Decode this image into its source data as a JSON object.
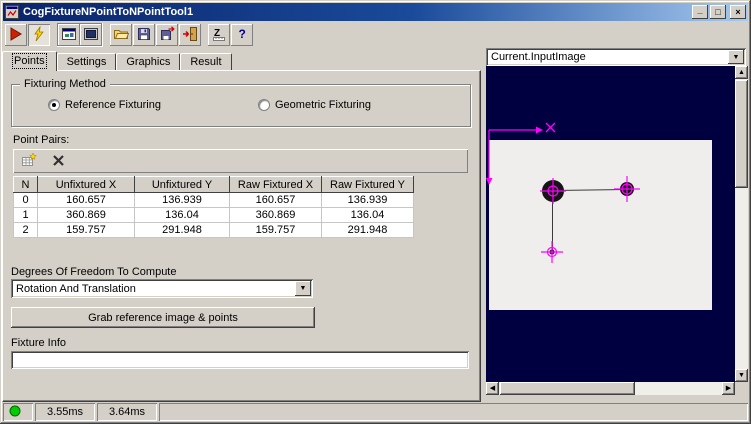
{
  "window": {
    "title": "CogFixtureNPointToNPointTool1",
    "minimize_label": "_",
    "maximize_label": "□",
    "close_label": "×"
  },
  "icons": {
    "scroll_up": "▲",
    "scroll_down": "▼",
    "scroll_left": "◀",
    "scroll_right": "▶",
    "dropdown_arrow": "▼"
  },
  "toolbar": {
    "buttons": [
      {
        "name": "run",
        "icon": "run-icon"
      },
      {
        "name": "auto-run",
        "icon": "lightning-icon",
        "pressed": true
      },
      {
        "name": "float-image-window",
        "icon": "image-window-icon"
      },
      {
        "name": "show-image-display",
        "icon": "image-display-icon"
      },
      {
        "name": "open-file",
        "icon": "open-folder-icon"
      },
      {
        "name": "save-file",
        "icon": "floppy-icon"
      },
      {
        "name": "export",
        "icon": "floppy-arrow-icon"
      },
      {
        "name": "import",
        "icon": "door-arrow-icon"
      },
      {
        "name": "tool-constants",
        "icon": "z-ruler-icon"
      },
      {
        "name": "help",
        "icon": "question-icon"
      }
    ]
  },
  "tabs": [
    {
      "label": "Points",
      "active": true
    },
    {
      "label": "Settings",
      "active": false
    },
    {
      "label": "Graphics",
      "active": false
    },
    {
      "label": "Result",
      "active": false
    }
  ],
  "points_tab": {
    "fixturing_method": {
      "group_label": "Fixturing Method",
      "options": [
        {
          "label": "Reference Fixturing",
          "selected": true
        },
        {
          "label": "Geometric Fixturing",
          "selected": false
        }
      ]
    },
    "point_pairs": {
      "label": "Point Pairs:",
      "columns": [
        "N",
        "Unfixtured X",
        "Unfixtured Y",
        "Raw Fixtured X",
        "Raw Fixtured Y"
      ],
      "rows": [
        [
          "0",
          "160.657",
          "136.939",
          "160.657",
          "136.939"
        ],
        [
          "1",
          "360.869",
          "136.04",
          "360.869",
          "136.04"
        ],
        [
          "2",
          "159.757",
          "291.948",
          "159.757",
          "291.948"
        ]
      ]
    },
    "dof": {
      "label": "Degrees Of Freedom To Compute",
      "value": "Rotation And Translation"
    },
    "grab_button_label": "Grab reference image & points",
    "fixture_info": {
      "label": "Fixture Info",
      "value": ""
    }
  },
  "image_panel": {
    "selector_value": "Current.InputImage"
  },
  "status_bar": {
    "time1": "3.55ms",
    "time2": "3.64ms"
  },
  "colors": {
    "face": "#d4d0c8",
    "title_gradient_start": "#0a246a",
    "title_gradient_end": "#a6caf0",
    "image_background": "#000040",
    "overlay_magenta": "#ff00ff",
    "status_ok_green": "#00cc00"
  }
}
